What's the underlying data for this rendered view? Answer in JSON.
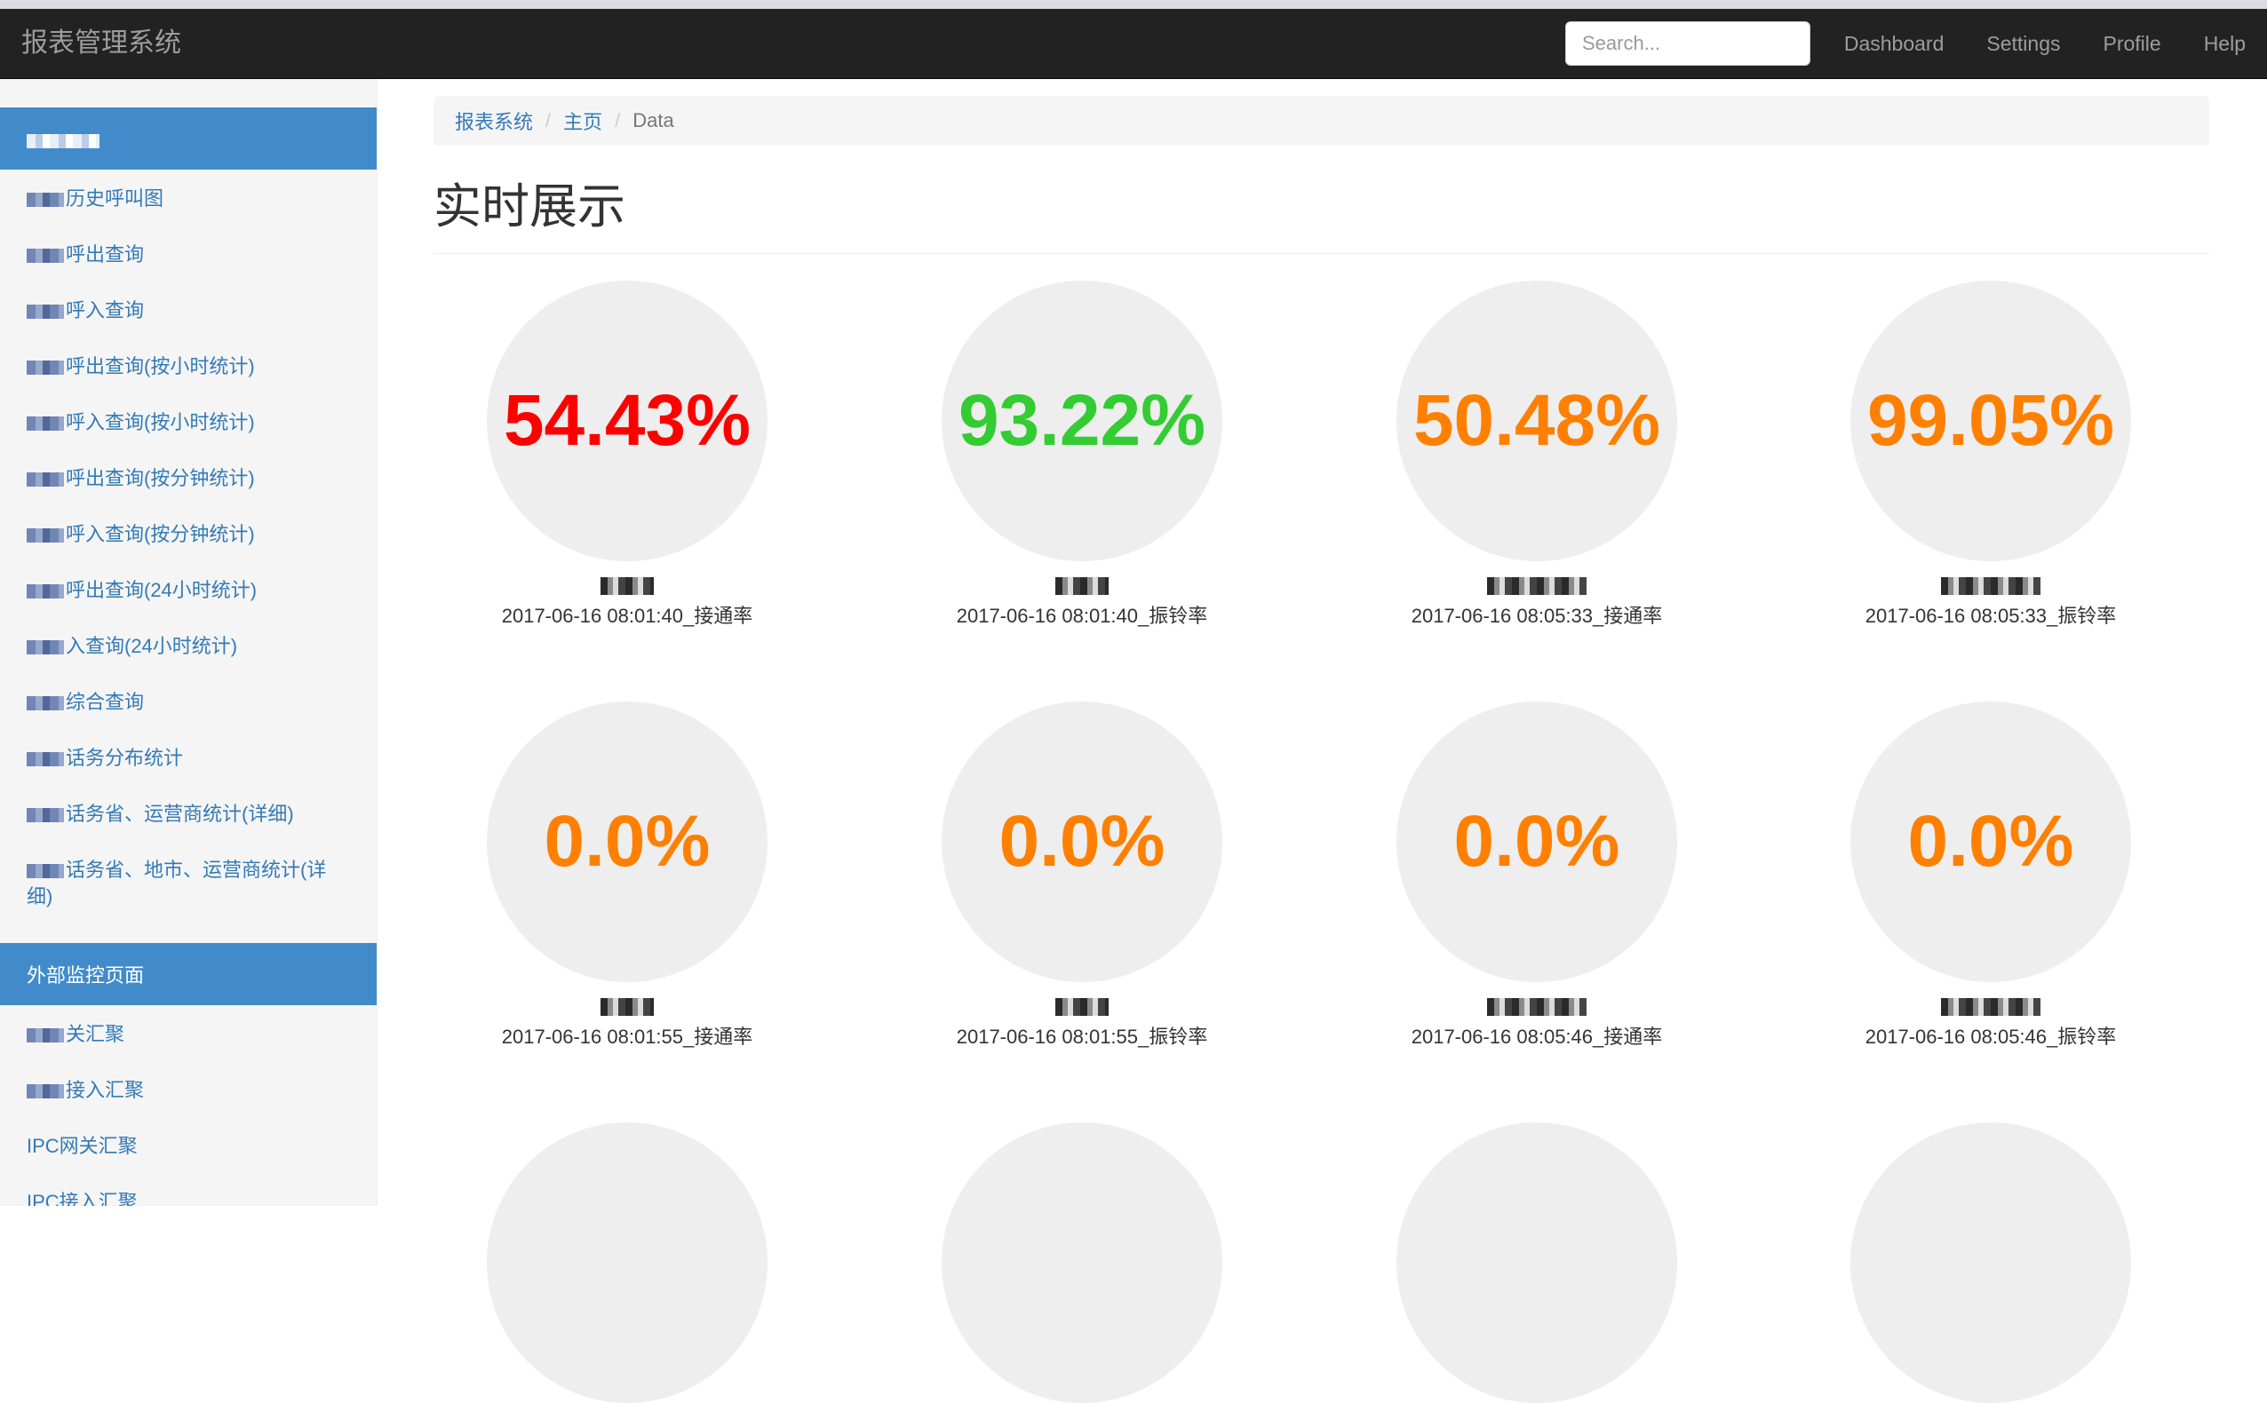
{
  "navbar": {
    "brand": "报表管理系统",
    "search_placeholder": "Search...",
    "links": [
      "Dashboard",
      "Settings",
      "Profile",
      "Help"
    ]
  },
  "sidebar": {
    "group1": [
      {
        "label": "",
        "active": true
      },
      {
        "label": "历史呼叫图"
      },
      {
        "label": "呼出查询"
      },
      {
        "label": "呼入查询"
      },
      {
        "label": "呼出查询(按小时统计)"
      },
      {
        "label": "呼入查询(按小时统计)"
      },
      {
        "label": "呼出查询(按分钟统计)"
      },
      {
        "label": "呼入查询(按分钟统计)"
      },
      {
        "label": "呼出查询(24小时统计)"
      },
      {
        "label": "入查询(24小时统计)"
      },
      {
        "label": "综合查询"
      },
      {
        "label": "话务分布统计"
      },
      {
        "label": "话务省、运营商统计(详细)"
      },
      {
        "label": "话务省、地市、运营商统计(详细)"
      }
    ],
    "group2": [
      {
        "label": "外部监控页面",
        "active": true
      },
      {
        "label": "关汇聚"
      },
      {
        "label": "接入汇聚"
      },
      {
        "label": "IPC网关汇聚"
      },
      {
        "label": "IPC接入汇聚"
      }
    ]
  },
  "breadcrumb": {
    "root": "报表系统",
    "home": "主页",
    "current": "Data"
  },
  "page_title": "实时展示",
  "colors": {
    "red": "#ff0000",
    "green": "#33cc33",
    "orange": "#ff8000"
  },
  "cards": [
    {
      "value": "54.43%",
      "caption": "2017-06-16 08:01:40_接通率",
      "color": "#ff0000"
    },
    {
      "value": "93.22%",
      "caption": "2017-06-16 08:01:40_振铃率",
      "color": "#33cc33"
    },
    {
      "value": "50.48%",
      "caption": "2017-06-16 08:05:33_接通率",
      "color": "#ff8000"
    },
    {
      "value": "99.05%",
      "caption": "2017-06-16 08:05:33_振铃率",
      "color": "#ff8000"
    },
    {
      "value": "0.0%",
      "caption": "2017-06-16 08:01:55_接通率",
      "color": "#ff8000"
    },
    {
      "value": "0.0%",
      "caption": "2017-06-16 08:01:55_振铃率",
      "color": "#ff8000"
    },
    {
      "value": "0.0%",
      "caption": "2017-06-16 08:05:46_接通率",
      "color": "#ff8000"
    },
    {
      "value": "0.0%",
      "caption": "2017-06-16 08:05:46_振铃率",
      "color": "#ff8000"
    },
    {
      "value": "",
      "caption": "",
      "color": "#ff8000"
    },
    {
      "value": "",
      "caption": "",
      "color": "#ff8000"
    },
    {
      "value": "",
      "caption": "",
      "color": "#ff8000"
    },
    {
      "value": "",
      "caption": "",
      "color": "#ff8000"
    }
  ]
}
